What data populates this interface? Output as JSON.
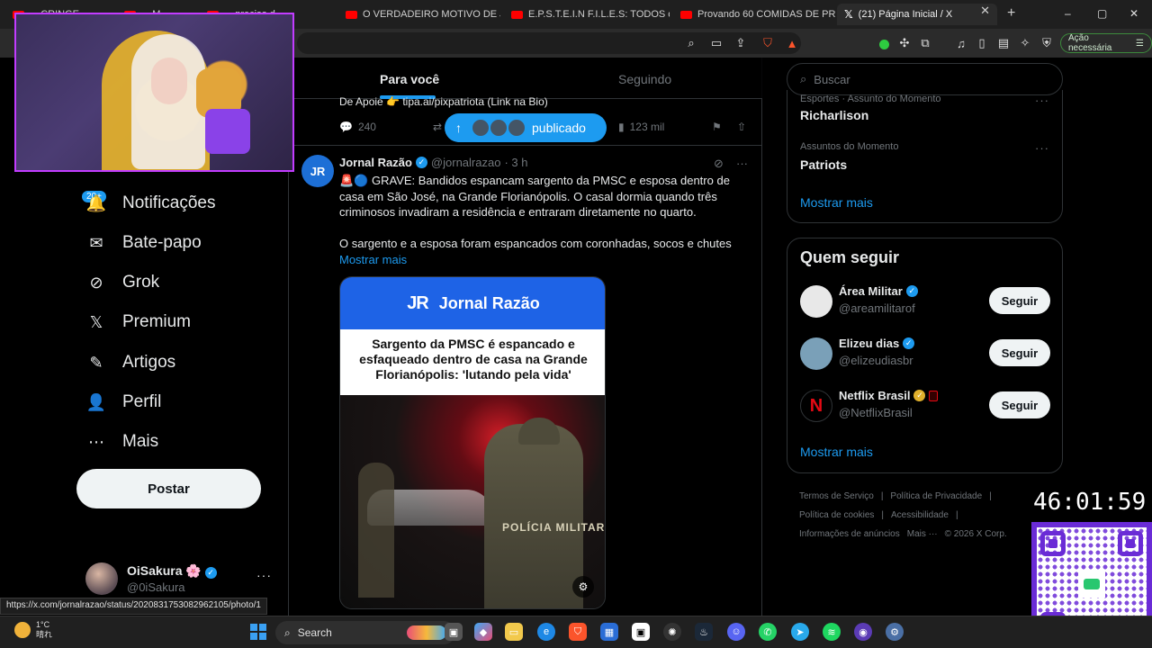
{
  "browser": {
    "tabs": [
      {
        "title": "... CRINGE ...",
        "kind": "youtube"
      },
      {
        "title": "... M...",
        "kind": "youtube"
      },
      {
        "title": "... preciso d",
        "kind": "youtube"
      },
      {
        "title": "O VERDADEIRO MOTIVO DE JET Li",
        "kind": "youtube"
      },
      {
        "title": "E.P.S.T.E.I.N F.I.L.E.S: TODOS os SEG",
        "kind": "youtube"
      },
      {
        "title": "Provando 60 COMIDAS DE PRAIA",
        "kind": "youtube"
      },
      {
        "title": "(21) Página Inicial / X",
        "kind": "x",
        "active": true
      }
    ],
    "new_tab": "+",
    "window_controls": [
      "–",
      "▢",
      "✕"
    ],
    "tab_close": "✕",
    "acao_label": "Ação necessária",
    "shield_badge": "3"
  },
  "nav": {
    "notifications_badge": "20+",
    "items": [
      {
        "label": "Notificações",
        "icon": "bell-icon",
        "glyph": "🔔"
      },
      {
        "label": "Bate-papo",
        "icon": "mail-icon",
        "glyph": "✉"
      },
      {
        "label": "Grok",
        "icon": "grok-icon",
        "glyph": "⊘"
      },
      {
        "label": "Premium",
        "icon": "x-logo-icon",
        "glyph": "𝕏"
      },
      {
        "label": "Artigos",
        "icon": "articles-icon",
        "glyph": "✎"
      },
      {
        "label": "Perfil",
        "icon": "profile-icon",
        "glyph": "👤"
      },
      {
        "label": "Mais",
        "icon": "more-circle-icon",
        "glyph": "⋯"
      }
    ],
    "post_button": "Postar",
    "profile": {
      "name": "OiSakura 🌸",
      "handle": "@0iSakura",
      "more": "···"
    }
  },
  "timeline": {
    "tabs": [
      "Para você",
      "Seguindo"
    ],
    "prev_tweet_line": "De Apoie 👉 tipa.ai/pixpatriota (Link na Bio)",
    "prev_actions": {
      "replies": "240",
      "views": "123 mil"
    },
    "published_pill": "publicado",
    "tweet": {
      "avatar_text": "JR",
      "name": "Jornal Razão",
      "handle": "@jornalrazao",
      "time": "· 3 h",
      "body": "🚨🔵 GRAVE: Bandidos espancam sargento da PMSC e esposa dentro de casa em São José, na Grande Florianópolis. O casal dormia quando três criminosos invadiram a residência e entraram diretamente no quarto.",
      "body2": "O sargento e a esposa foram espancados com coronhadas, socos e chutes",
      "show_more": "Mostrar mais",
      "media": {
        "logo": "JR",
        "brand": "Jornal Razão",
        "headline": "Sargento da PMSC é espancado e esfaqueado dentro de casa na Grande Florianópolis: 'lutando pela vida'",
        "photo_text": "POLÍCIA MILITAR"
      }
    }
  },
  "right": {
    "search_placeholder": "Buscar",
    "trends": [
      {
        "category": "Esportes · Assunto do Momento",
        "name": "Richarlison"
      },
      {
        "category": "Assuntos do Momento",
        "name": "Patriots"
      }
    ],
    "trends_more": "Mostrar mais",
    "who_to_follow": {
      "title": "Quem seguir",
      "accounts": [
        {
          "name": "Área Militar",
          "handle": "@areamilitarof",
          "verified": "blue",
          "avatar_color": "#e8e8e8"
        },
        {
          "name": "Elizeu dias",
          "handle": "@elizeudiasbr",
          "verified": "blue",
          "avatar_color": "#7aa0b8"
        },
        {
          "name": "Netflix Brasil",
          "handle": "@NetflixBrasil",
          "verified": "gold",
          "avatar_color": "#000000"
        }
      ],
      "follow_label": "Seguir",
      "more": "Mostrar mais"
    },
    "footer": [
      "Termos de Serviço",
      "|",
      "Política de Privacidade",
      "|",
      "Política de cookies",
      "|",
      "Acessibilidade",
      "|",
      "Informações de anúncios",
      "Mais ···",
      "© 2026 X Corp."
    ]
  },
  "overlay": {
    "timer": "46:01:59",
    "status_url": "https://x.com/jornalrazao/status/2020831753082962105/photo/1"
  },
  "taskbar": {
    "weather_temp": "1°C",
    "weather_text": "晴れ",
    "search_label": "Search",
    "pinned_badges": {
      "discord": "9+",
      "whatsapp": "1",
      "telegram": "55"
    }
  },
  "colors": {
    "accent": "#1d9bf0",
    "stream_frame": "#c23cff",
    "qr_purple": "#6a2bd6"
  }
}
